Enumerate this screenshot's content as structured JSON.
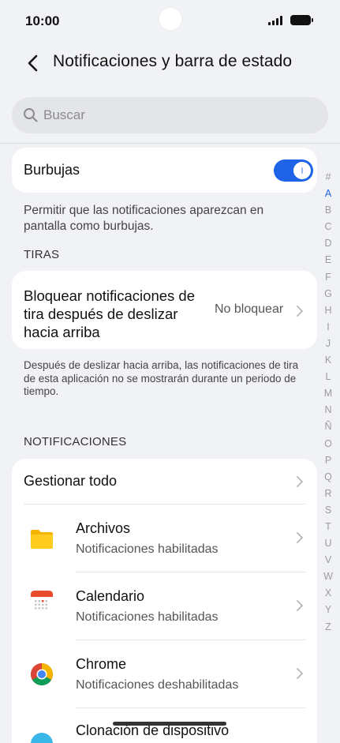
{
  "status_bar": {
    "time": "10:00"
  },
  "header": {
    "title": "Notificaciones y barra de estado"
  },
  "search": {
    "placeholder": "Buscar"
  },
  "bubbles": {
    "label": "Burbujas",
    "enabled": true,
    "description": "Permitir que las notificaciones aparezcan en pantalla como burbujas."
  },
  "banners": {
    "section_label": "TIRAS",
    "block_label": "Bloquear notificaciones de tira después de deslizar hacia arriba",
    "block_value": "No bloquear",
    "description": "Después de deslizar hacia arriba, las notificaciones de tira de esta aplicación no se mostrarán durante un periodo de tiempo."
  },
  "notifications": {
    "section_label": "NOTIFICACIONES",
    "manage_all": "Gestionar todo",
    "apps": [
      {
        "name": "Archivos",
        "status": "Notificaciones habilitadas",
        "icon": "files-icon"
      },
      {
        "name": "Calendario",
        "status": "Notificaciones habilitadas",
        "icon": "calendar-icon"
      },
      {
        "name": "Chrome",
        "status": "Notificaciones deshabilitadas",
        "icon": "chrome-icon"
      },
      {
        "name": "Clonación de dispositivo",
        "status": "",
        "icon": "device-clone-icon"
      }
    ]
  },
  "index": [
    "#",
    "A",
    "B",
    "C",
    "D",
    "E",
    "F",
    "G",
    "H",
    "I",
    "J",
    "K",
    "L",
    "M",
    "N",
    "Ñ",
    "O",
    "P",
    "Q",
    "R",
    "S",
    "T",
    "U",
    "V",
    "W",
    "X",
    "Y",
    "Z"
  ],
  "index_active": "A",
  "colors": {
    "accent": "#1f64e6",
    "background": "#f1f2f5",
    "card": "#ffffff"
  }
}
